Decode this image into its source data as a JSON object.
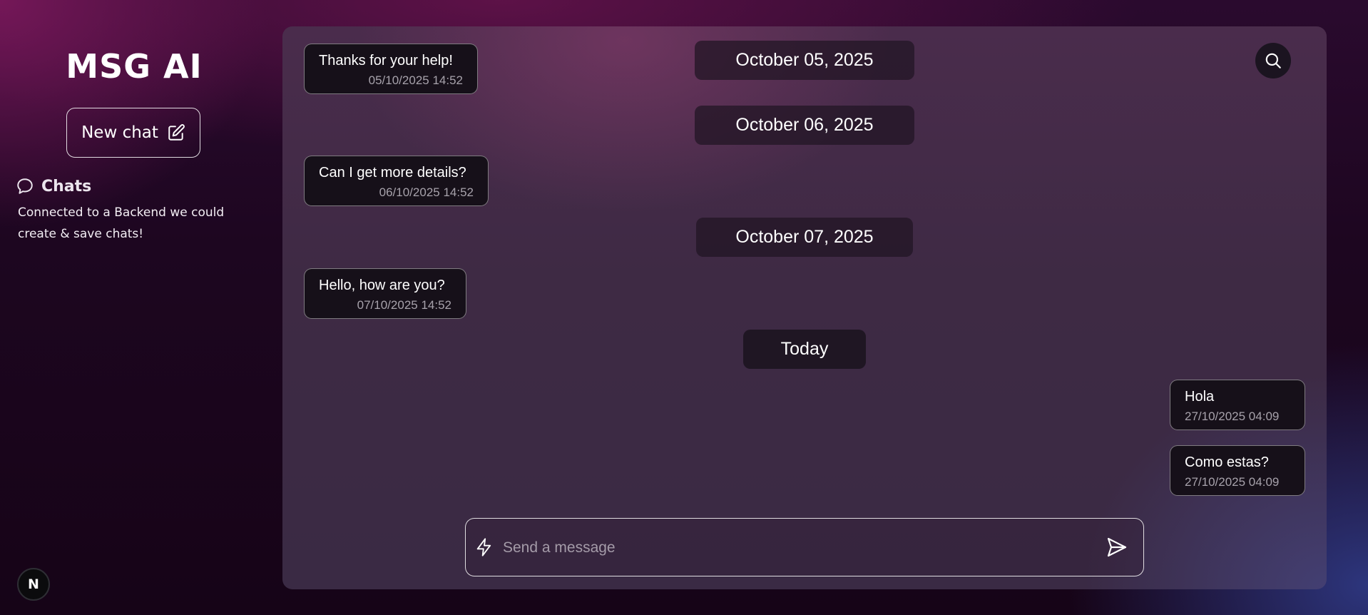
{
  "sidebar": {
    "brand": "MSG AI",
    "new_chat_label": "New chat",
    "chats_title": "Chats",
    "chats_note": "Connected to a Backend we could create & save chats!",
    "badge": "N"
  },
  "messages": [
    {
      "text": "Thanks for your help!",
      "time": "05/10/2025 14:52",
      "side": "received"
    },
    {
      "text": "Can I get more details?",
      "time": "06/10/2025 14:52",
      "side": "received"
    },
    {
      "text": "Hello, how are you?",
      "time": "07/10/2025 14:52",
      "side": "received"
    },
    {
      "text": "Hola",
      "time": "27/10/2025 04:09",
      "side": "sent"
    },
    {
      "text": "Como estas?",
      "time": "27/10/2025 04:09",
      "side": "sent"
    }
  ],
  "dates": [
    "October 05, 2025",
    "October 06, 2025",
    "October 07, 2025",
    "Today"
  ],
  "composer": {
    "placeholder": "Send a message",
    "value": ""
  },
  "icons": {
    "new_chat": "edit-icon",
    "chats": "chat-bubble-icon",
    "search": "search-icon",
    "composer_left": "bolt-icon",
    "send": "send-icon"
  }
}
